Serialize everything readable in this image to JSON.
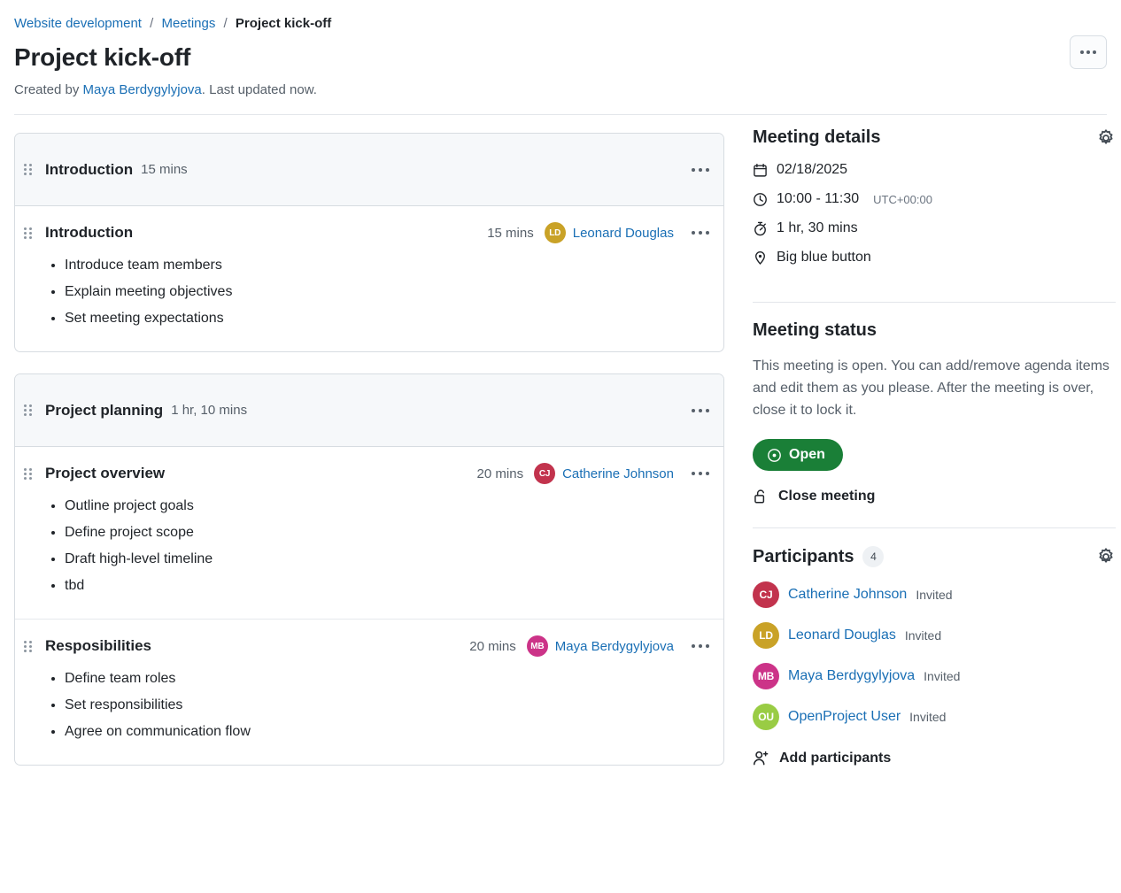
{
  "breadcrumb": {
    "project": "Website development",
    "section": "Meetings",
    "current": "Project kick-off",
    "separator": "/"
  },
  "header": {
    "title": "Project kick-off",
    "created_prefix": "Created by ",
    "created_by": "Maya Berdygylyjova",
    "created_suffix": ". Last updated now."
  },
  "agenda": {
    "sections": [
      {
        "title": "Introduction",
        "duration": "15 mins",
        "items": [
          {
            "title": "Introduction",
            "duration": "15 mins",
            "owner": "Leonard Douglas",
            "owner_initials": "LD",
            "owner_color": "#c9a227",
            "notes": [
              "Introduce team members",
              "Explain meeting objectives",
              "Set meeting expectations"
            ]
          }
        ]
      },
      {
        "title": "Project planning",
        "duration": "1 hr, 10 mins",
        "items": [
          {
            "title": "Project overview",
            "duration": "20 mins",
            "owner": "Catherine Johnson",
            "owner_initials": "CJ",
            "owner_color": "#c2334d",
            "notes": [
              "Outline project goals",
              "Define project scope",
              "Draft high-level timeline",
              "tbd"
            ]
          },
          {
            "title": "Resposibilities",
            "duration": "20 mins",
            "owner": "Maya Berdygylyjova",
            "owner_initials": "MB",
            "owner_color": "#cc3388",
            "notes": [
              "Define team roles",
              "Set responsibilities",
              "Agree on communication flow"
            ]
          }
        ]
      }
    ]
  },
  "details": {
    "heading": "Meeting details",
    "date": "02/18/2025",
    "time": "10:00 - 11:30",
    "timezone": "UTC+00:00",
    "duration": "1 hr, 30 mins",
    "location": "Big blue button"
  },
  "status": {
    "heading": "Meeting status",
    "description": "This meeting is open. You can add/remove agenda items and edit them as you please. After the meeting is over, close it to lock it.",
    "pill_label": "Open",
    "pill_color": "#1a7f37",
    "close_label": "Close meeting"
  },
  "participants": {
    "heading": "Participants",
    "count": "4",
    "add_label": "Add participants",
    "list": [
      {
        "name": "Catherine Johnson",
        "initials": "CJ",
        "color": "#c2334d",
        "status": "Invited"
      },
      {
        "name": "Leonard Douglas",
        "initials": "LD",
        "color": "#c9a227",
        "status": "Invited"
      },
      {
        "name": "Maya Berdygylyjova",
        "initials": "MB",
        "color": "#cc3388",
        "status": "Invited"
      },
      {
        "name": "OpenProject User",
        "initials": "OU",
        "color": "#99cc44",
        "status": "Invited"
      }
    ]
  },
  "colors": {
    "link": "#1a6fb5",
    "accent_green": "#1a7f37",
    "section_bg": "#f6f8fa",
    "border": "#d7dce1"
  }
}
